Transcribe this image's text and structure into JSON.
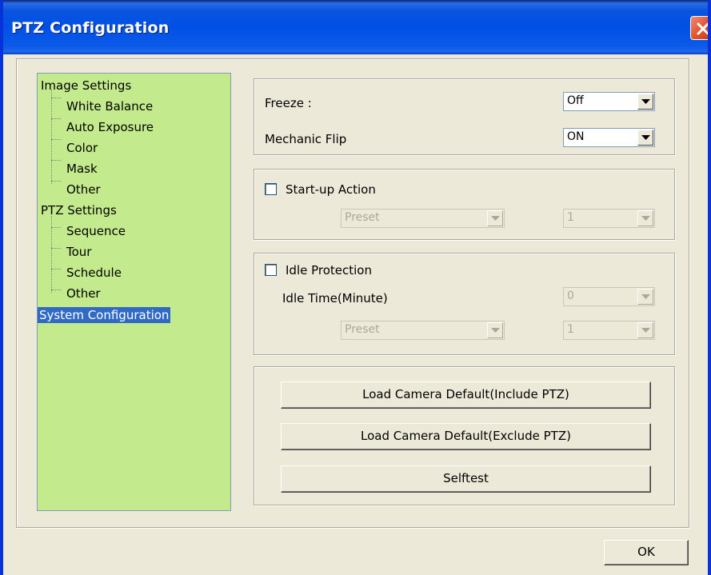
{
  "window": {
    "title": "PTZ Configuration"
  },
  "tree": {
    "items": [
      {
        "label": "Image Settings",
        "level": 0
      },
      {
        "label": "White Balance",
        "level": 1
      },
      {
        "label": "Auto Exposure",
        "level": 1
      },
      {
        "label": "Color",
        "level": 1
      },
      {
        "label": "Mask",
        "level": 1
      },
      {
        "label": "Other",
        "level": 1
      },
      {
        "label": "PTZ Settings",
        "level": 0
      },
      {
        "label": "Sequence",
        "level": 1
      },
      {
        "label": "Tour",
        "level": 1
      },
      {
        "label": "Schedule",
        "level": 1
      },
      {
        "label": "Other",
        "level": 1
      },
      {
        "label": "System Configuration",
        "level": 0,
        "selected": true
      }
    ]
  },
  "freeze": {
    "label": "Freeze :",
    "value": "Off"
  },
  "mechanic_flip": {
    "label": "Mechanic Flip",
    "value": "ON"
  },
  "startup": {
    "label": "Start-up Action",
    "checked": false,
    "mode": "Preset",
    "number": "1"
  },
  "idle": {
    "label": "Idle Protection",
    "checked": false,
    "time_label": "Idle Time(Minute)",
    "time_value": "0",
    "mode": "Preset",
    "number": "1"
  },
  "buttons": {
    "load_include": "Load Camera Default(Include PTZ)",
    "load_exclude": "Load Camera Default(Exclude PTZ)",
    "selftest": "Selftest",
    "ok": "OK"
  },
  "colors": {
    "titlebar": "#0054e3",
    "tree_bg": "#c3ea8d",
    "selection": "#316ac5",
    "dialog_bg": "#ece9d8",
    "close": "#e2552f"
  },
  "icons": {
    "close": "close-icon",
    "dropdown": "chevron-down-icon"
  }
}
